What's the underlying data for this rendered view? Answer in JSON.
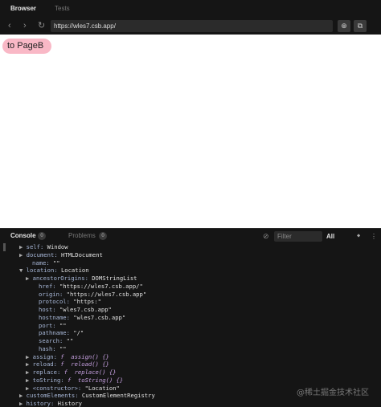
{
  "tabs": {
    "browser": "Browser",
    "tests": "Tests"
  },
  "nav": {
    "back": "‹",
    "forward": "›",
    "refresh": "↻",
    "url": "https://wles7.csb.app/",
    "open_icon": "⊕",
    "external_icon": "⧉"
  },
  "preview": {
    "button_label": "to PageB"
  },
  "console": {
    "tab_console": "Console",
    "console_count": "0",
    "tab_problems": "Problems",
    "problems_count": "0",
    "filter_placeholder": "Filter",
    "level": "All",
    "lines": [
      {
        "tri": "▶",
        "indent": 32,
        "key": "self",
        "val": "Window"
      },
      {
        "tri": "▶",
        "indent": 32,
        "key": "document",
        "val": "HTMLDocument"
      },
      {
        "tri": "",
        "indent": 40,
        "key": "name",
        "val": "\"\""
      },
      {
        "tri": "▼",
        "indent": 32,
        "key": "location",
        "val": "Location"
      },
      {
        "tri": "▶",
        "indent": 40,
        "key": "ancestorOrigins",
        "val": "DOMStringList"
      },
      {
        "tri": "",
        "indent": 48,
        "key": "href",
        "val": "\"https://wles7.csb.app/\""
      },
      {
        "tri": "",
        "indent": 48,
        "key": "origin",
        "val": "\"https://wles7.csb.app\""
      },
      {
        "tri": "",
        "indent": 48,
        "key": "protocol",
        "val": "\"https:\""
      },
      {
        "tri": "",
        "indent": 48,
        "key": "host",
        "val": "\"wles7.csb.app\""
      },
      {
        "tri": "",
        "indent": 48,
        "key": "hostname",
        "val": "\"wles7.csb.app\""
      },
      {
        "tri": "",
        "indent": 48,
        "key": "port",
        "val": "\"\""
      },
      {
        "tri": "",
        "indent": 48,
        "key": "pathname",
        "val": "\"/\""
      },
      {
        "tri": "",
        "indent": 48,
        "key": "search",
        "val": "\"\""
      },
      {
        "tri": "",
        "indent": 48,
        "key": "hash",
        "val": "\"\""
      },
      {
        "tri": "▶",
        "indent": 40,
        "key": "assign",
        "val": "f  assign() {}"
      },
      {
        "tri": "▶",
        "indent": 40,
        "key": "reload",
        "val": "f  reload() {}"
      },
      {
        "tri": "▶",
        "indent": 40,
        "key": "replace",
        "val": "f  replace() {}"
      },
      {
        "tri": "▶",
        "indent": 40,
        "key": "toString",
        "val": "f  toString() {}"
      },
      {
        "tri": "▶",
        "indent": 40,
        "key": "<constructor>",
        "val": "\"Location\""
      },
      {
        "tri": "▶",
        "indent": 32,
        "key": "customElements",
        "val": "CustomElementRegistry"
      },
      {
        "tri": "▶",
        "indent": 32,
        "key": "history",
        "val": "History"
      }
    ]
  },
  "watermark": "@稀土掘金技术社区"
}
